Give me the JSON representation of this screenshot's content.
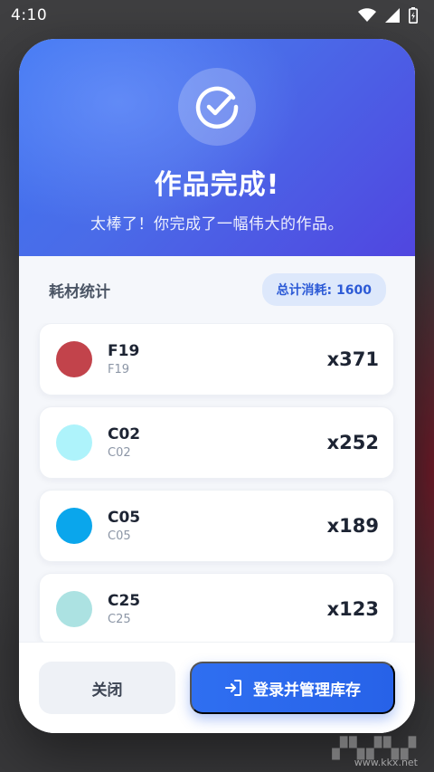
{
  "status_bar": {
    "time": "4:10",
    "icons": [
      "wifi-icon",
      "cellular-signal-icon",
      "battery-charging-icon"
    ]
  },
  "dialog": {
    "icon": "check-circle-icon",
    "title": "作品完成!",
    "subtitle": "太棒了！你完成了一幅伟大的作品。"
  },
  "stats": {
    "label": "耗材统计",
    "total_badge": "总计消耗: 1600"
  },
  "items": [
    {
      "code": "F19",
      "sub": "F19",
      "count": "x371",
      "color": "#c2434b"
    },
    {
      "code": "C02",
      "sub": "C02",
      "count": "x252",
      "color": "#aef3fb"
    },
    {
      "code": "C05",
      "sub": "C05",
      "count": "x189",
      "color": "#0aa6ec"
    },
    {
      "code": "C25",
      "sub": "C25",
      "count": "x123",
      "color": "#ace2e2"
    }
  ],
  "footer": {
    "close_label": "关闭",
    "login_label": "登录并管理库存",
    "login_icon": "login-arrow-icon"
  },
  "colors": {
    "accent": "#2f6ff1",
    "header_start": "#3f76f2",
    "header_end": "#5046e0"
  },
  "watermark": {
    "url": "www.kkx.net"
  }
}
